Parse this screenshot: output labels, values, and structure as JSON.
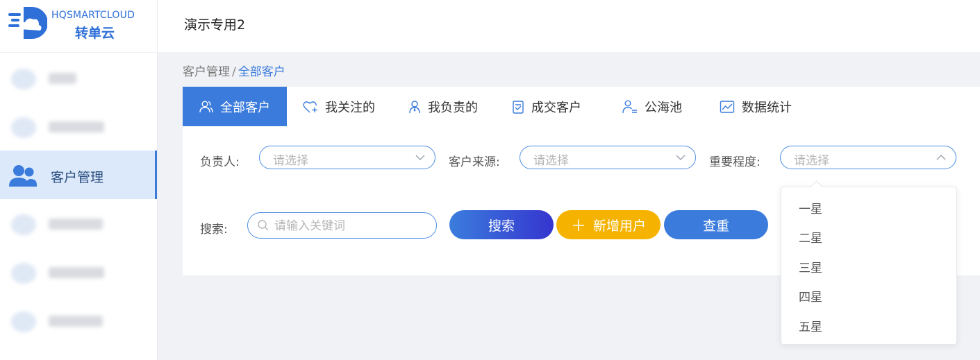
{
  "brand": {
    "name_en": "HQSMARTCLOUD",
    "name_cn": "转单云",
    "color": "#2e6fd8"
  },
  "topbar": {
    "title": "演示专用2"
  },
  "sidebar": {
    "active_item": {
      "label": "客户管理",
      "icon": "users-icon"
    }
  },
  "breadcrumb": {
    "parent": "客户管理",
    "separator": "/",
    "current": "全部客户"
  },
  "tabs": [
    {
      "label": "全部客户",
      "icon": "users-outline-icon",
      "active": true
    },
    {
      "label": "我关注的",
      "icon": "heart-plus-icon"
    },
    {
      "label": "我负责的",
      "icon": "person-icon"
    },
    {
      "label": "成交客户",
      "icon": "clipboard-check-icon"
    },
    {
      "label": "公海池",
      "icon": "person-list-icon"
    },
    {
      "label": "数据统计",
      "icon": "line-chart-icon"
    }
  ],
  "filters": {
    "owner": {
      "label": "负责人:",
      "placeholder": "请选择"
    },
    "source": {
      "label": "客户来源:",
      "placeholder": "请选择"
    },
    "importance": {
      "label": "重要程度:",
      "placeholder": "请选择",
      "open": true,
      "options": [
        "一星",
        "二星",
        "三星",
        "四星",
        "五星"
      ]
    },
    "search": {
      "label": "搜索:",
      "placeholder": "请输入关键词",
      "value": ""
    }
  },
  "buttons": {
    "search": "搜索",
    "add_user": "新增用户",
    "reset": "查重"
  },
  "colors": {
    "primary": "#3a7bdc",
    "accent": "#f5b300",
    "gradient_end": "#3535cf"
  }
}
